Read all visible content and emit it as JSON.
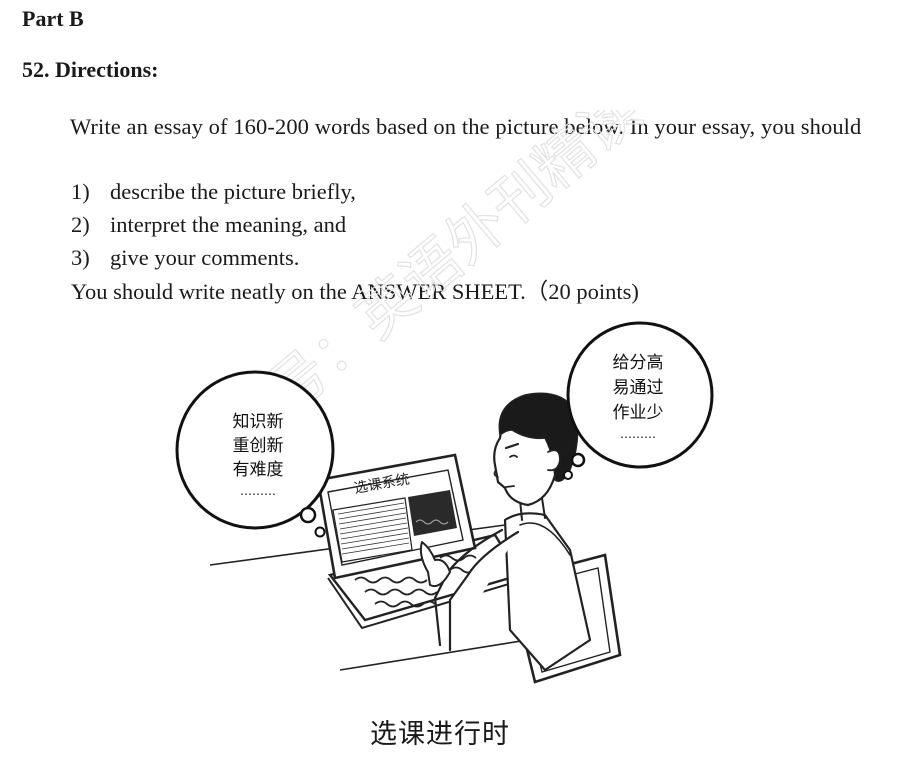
{
  "heading": {
    "part": "Part B",
    "directions": "52. Directions:"
  },
  "instructions": {
    "intro": "Write an essay of 160-200 words based on the picture below. In your essay, you should",
    "items": [
      {
        "num": "1)",
        "text": "describe the picture briefly,"
      },
      {
        "num": "2)",
        "text": "interpret the meaning, and"
      },
      {
        "num": "3)",
        "text": "give your comments."
      }
    ],
    "closing": "You should write neatly on the ANSWER SHEET.（20 points)"
  },
  "cartoon": {
    "left_bubble": [
      "知识新",
      "重创新",
      "有难度",
      "………"
    ],
    "right_bubble": [
      "给分高",
      "易通过",
      "作业少",
      "………"
    ],
    "screen_title": "选课系统",
    "caption": "选课进行时"
  },
  "watermark": {
    "text": "公众号：英语外刊精读"
  }
}
